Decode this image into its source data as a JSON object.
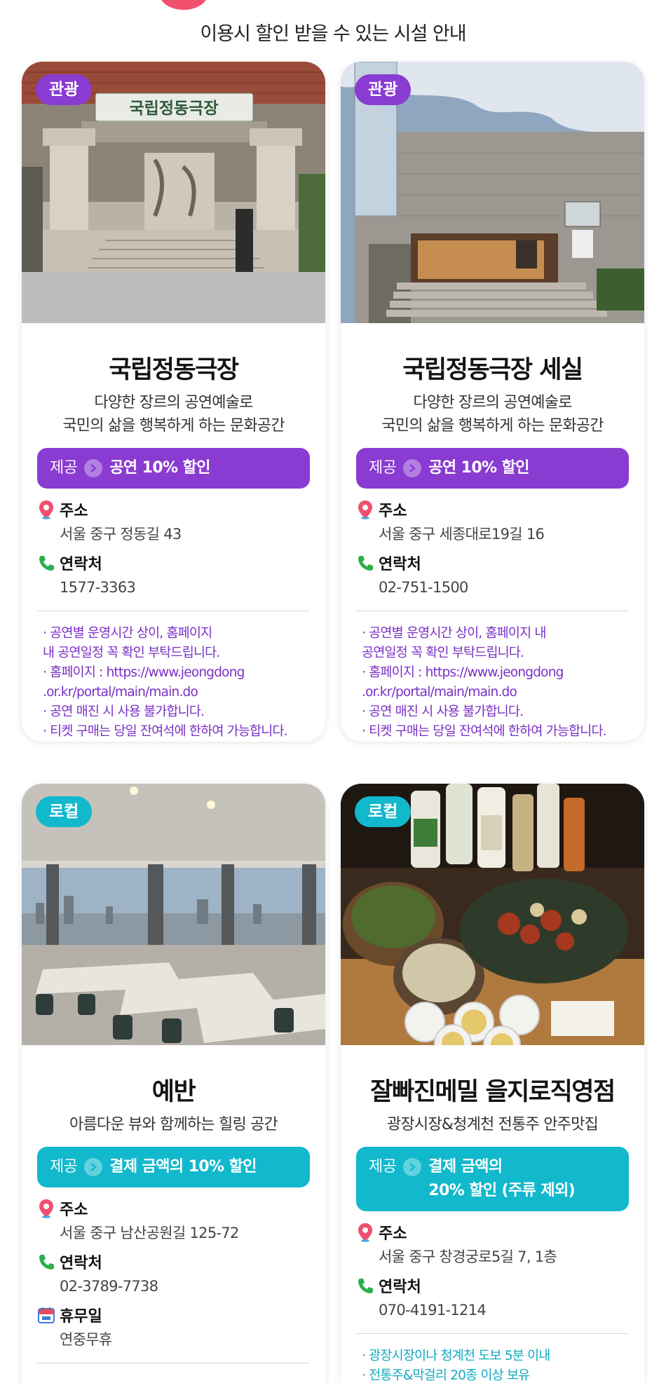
{
  "page": {
    "heading": "이용시 할인 받을 수 있는 시설 안내"
  },
  "colors": {
    "tour_accent": "#8a3bd1",
    "local_accent": "#12b8cc"
  },
  "cards": [
    {
      "tag": "관광",
      "title": "국립정동극장",
      "desc": "다양한 장르의 공연예술로\n국민의 삶을 행복하게 하는 문화공간",
      "benefit_prefix": "제공",
      "benefit": "공연 10% 할인",
      "address_label": "주소",
      "address": "서울 중구 정동길 43",
      "contact_label": "연락처",
      "contact": "1577-3363",
      "notes": "· 공연별 운영시간 상이, 홈페이지\n  내 공연일정 꼭 확인 부탁드립니다.\n· 홈페이지 : https://www.jeongdong\n  .or.kr/portal/main/main.do\n· 공연 매진 시 사용 불가합니다.\n· 티켓 구매는 당일 잔여석에 한하여 가능합니다.",
      "photo_sign": "국립정동극장"
    },
    {
      "tag": "관광",
      "title": "국립정동극장 세실",
      "desc": "다양한 장르의 공연예술로\n국민의 삶을 행복하게 하는 문화공간",
      "benefit_prefix": "제공",
      "benefit": "공연 10% 할인",
      "address_label": "주소",
      "address": "서울 중구 세종대로19길 16",
      "contact_label": "연락처",
      "contact": "02-751-1500",
      "notes": "· 공연별 운영시간 상이, 홈페이지 내\n  공연일정 꼭 확인 부탁드립니다.\n· 홈페이지 : https://www.jeongdong\n  .or.kr/portal/main/main.do\n· 공연 매진 시 사용 불가합니다.\n· 티켓 구매는 당일 잔여석에 한하여 가능합니다."
    },
    {
      "tag": "로컬",
      "title": "예반",
      "desc": "아름다운 뷰와 함께하는 힐링 공간",
      "benefit_prefix": "제공",
      "benefit": "결제 금액의 10% 할인",
      "address_label": "주소",
      "address": "서울 중구 남산공원길 125-72",
      "contact_label": "연락처",
      "contact": "02-3789-7738",
      "holiday_label": "휴무일",
      "holiday": "연중무휴"
    },
    {
      "tag": "로컬",
      "title": "잘빠진메밀 을지로직영점",
      "desc": "광장시장&청계천 전통주 안주맛집",
      "benefit_prefix": "제공",
      "benefit": "결제 금액의\n20% 할인 (주류 제외)",
      "address_label": "주소",
      "address": "서울 중구 창경궁로5길 7, 1층",
      "contact_label": "연락처",
      "contact": "070-4191-1214",
      "notes": "· 광장시장이나 청계천 도보 5분 이내\n· 전통주&막걸리 20종 이상 보유"
    }
  ],
  "icons": {
    "address": "map-pin-icon",
    "contact": "phone-icon",
    "holiday": "calendar-icon",
    "benefit": "chevron-right-icon"
  }
}
